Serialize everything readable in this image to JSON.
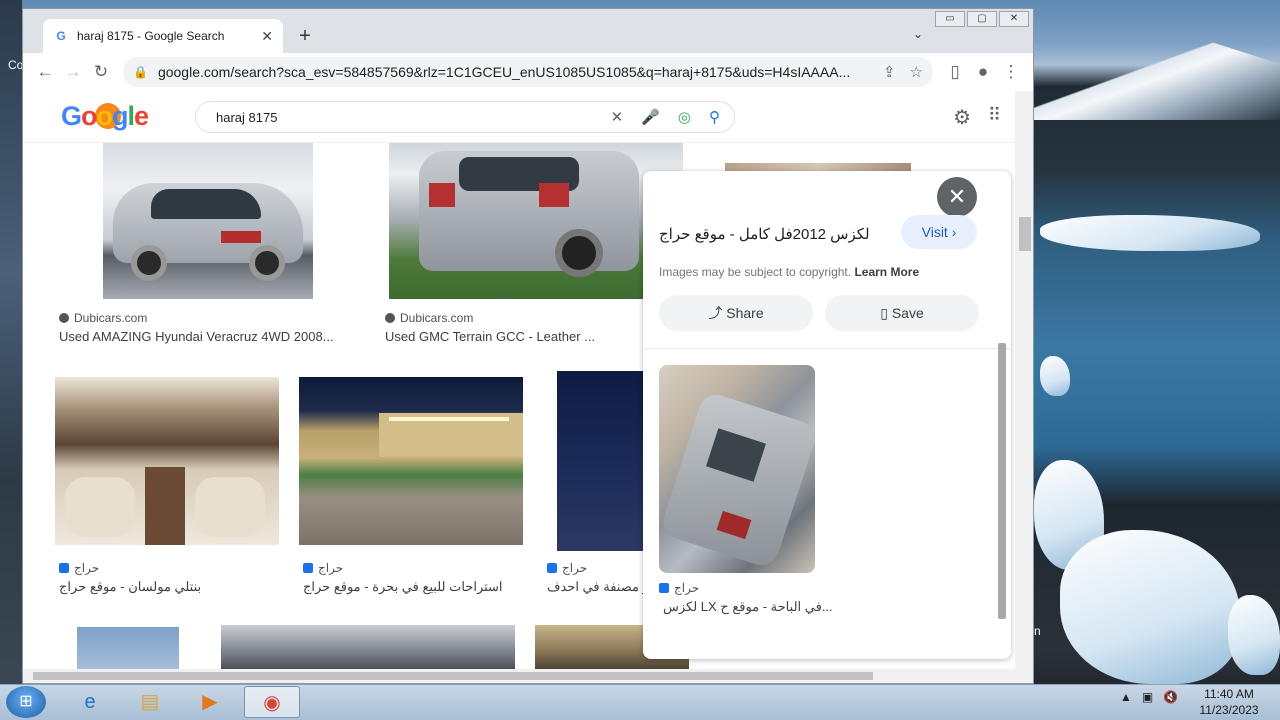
{
  "desktop": {
    "left_label": "Co",
    "right_label": "n"
  },
  "window": {
    "controls": [
      "▭",
      "▢",
      "✕"
    ]
  },
  "tab": {
    "title": "haraj 8175 - Google Search",
    "favicon": "G",
    "close": "✕",
    "new_tab": "+",
    "tab_search": "⌄"
  },
  "toolbar": {
    "back": "←",
    "forward": "→",
    "reload": "↻",
    "url": "google.com/search?sca_esv=584857569&rlz=1C1GCEU_enUS1085US1085&q=haraj+8175&uds=H4sIAAAA...",
    "share_icon": "⇪",
    "star_icon": "☆",
    "sidepanel_icon": "▯",
    "profile_icon": "●",
    "menu_icon": "⋮"
  },
  "google": {
    "logo_letters": [
      "G",
      "o",
      "o",
      "g",
      "l",
      "e"
    ],
    "query": "haraj 8175",
    "clear": "✕"
  },
  "results": {
    "row1": [
      {
        "source": "Dubicars.com",
        "caption": "Used AMAZING Hyundai Veracruz 4WD 2008..."
      },
      {
        "source": "Dubicars.com",
        "caption": "Used GMC Terrain GCC - Leather ..."
      }
    ],
    "row2": [
      {
        "source": "حراج",
        "caption": "بنتلي مولسان - موقع حراج"
      },
      {
        "source": "حراج",
        "caption": "استراحات للبيع في بحرة - موقع حراج"
      },
      {
        "source": "حراج",
        "caption": "ر مصنفة في احدف..."
      }
    ]
  },
  "panel": {
    "close": "✕",
    "title": "لكزس 2012فل كامل - موقع حراج",
    "visit": "Visit ›",
    "copyright": "Images may be subject to copyright.",
    "learn_more": "Learn More",
    "share": "Share",
    "save": "Save",
    "related_source": "حراج",
    "related_caption": "لكزس LX في الباحة - موقع ح..."
  },
  "taskbar": {
    "time": "11:40 AM",
    "date": "11/23/2023",
    "tray_up": "▲",
    "tray_network": "▣",
    "tray_volume": "🔇"
  },
  "colors": {
    "google_blue": "#4285f4",
    "visit_bg": "#e8f0fe",
    "taskbar": "#b7cadd"
  }
}
